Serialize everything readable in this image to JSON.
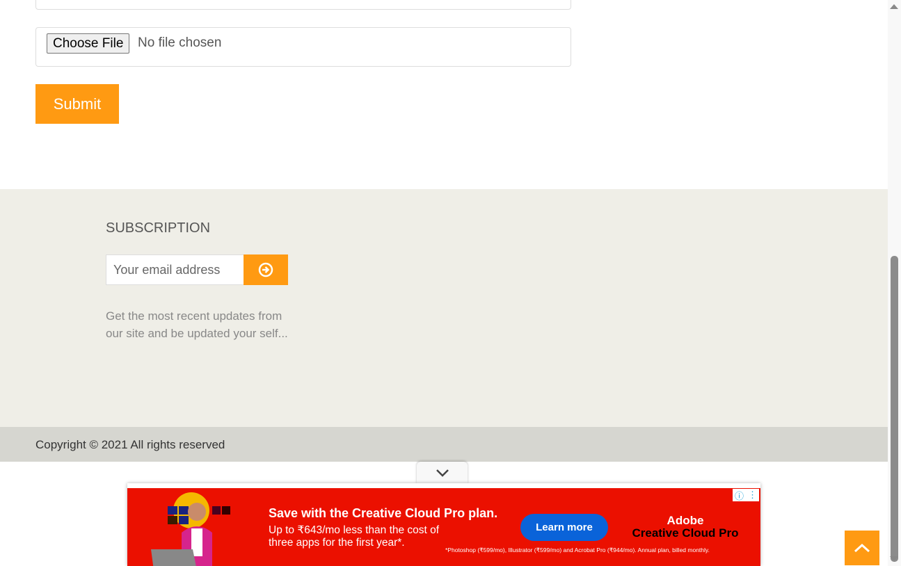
{
  "form": {
    "choose_file_label": "Choose File",
    "file_status": "No file chosen",
    "submit_label": "Submit"
  },
  "footer": {
    "subscription_title": "SUBSCRIPTION",
    "email_placeholder": "Your email address",
    "description": "Get the most recent updates from our site and be updated your self...",
    "copyright": "Copyright © 2021 All rights reserved"
  },
  "ad": {
    "headline": "Save with the Creative Cloud Pro plan.",
    "subtext": "Up to ₹643/mo less than the cost of three apps for the first year*.",
    "cta": "Learn more",
    "brand_line1": "Adobe",
    "brand_line2": "Creative Cloud Pro",
    "fine_print": "*Photoshop (₹599/mo), Illustrator (₹599/mo) and Acrobat Pro (₹944/mo). Annual plan, billed monthly.",
    "colors": {
      "background": "#eb1000",
      "cta": "#0a63d9"
    }
  },
  "colors": {
    "accent": "#ff9a12",
    "footer_bg": "#efeee7",
    "copyright_bg": "#d6d6d0"
  }
}
